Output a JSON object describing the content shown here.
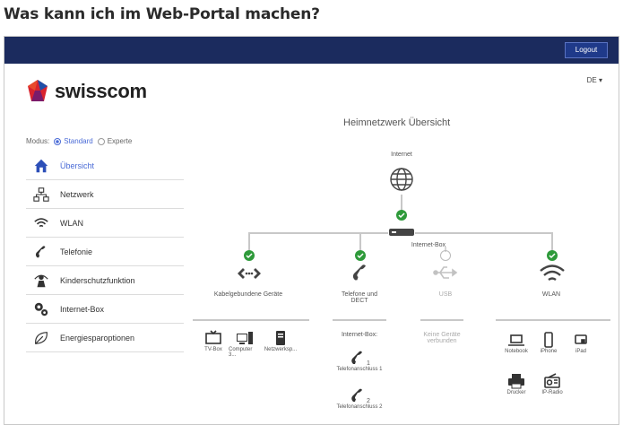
{
  "page_heading": "Was kann ich im Web-Portal machen?",
  "header": {
    "logout_label": "Logout",
    "language": "DE ▾"
  },
  "brand": {
    "name": "swisscom"
  },
  "modus": {
    "label": "Modus:",
    "standard": "Standard",
    "experte": "Experte"
  },
  "sidebar": {
    "items": [
      {
        "label": "Übersicht",
        "icon": "home-icon"
      },
      {
        "label": "Netzwerk",
        "icon": "network-icon"
      },
      {
        "label": "WLAN",
        "icon": "wifi-icon"
      },
      {
        "label": "Telefonie",
        "icon": "phone-icon"
      },
      {
        "label": "Kinderschutzfunktion",
        "icon": "parental-icon"
      },
      {
        "label": "Internet-Box",
        "icon": "gear-icon"
      },
      {
        "label": "Energiesparoptionen",
        "icon": "leaf-icon"
      }
    ]
  },
  "overview": {
    "title": "Heimnetzwerk Übersicht",
    "internet": "Internet",
    "internet_box": "Internet-Box",
    "branches": {
      "wired": "Kabelgebundene Geräte",
      "phone": "Telefone und DECT",
      "usb": "USB",
      "wlan": "WLAN"
    },
    "wired_devices": [
      "TV-Box",
      "Computer 3...",
      "Netzwerksp..."
    ],
    "phone_header": "Internet-Box:",
    "phone_ports": [
      "Telefonanschluss 1",
      "Telefonanschluss 2"
    ],
    "phone_port_numbers": [
      "1",
      "2"
    ],
    "usb_status": "Keine Geräte verbunden",
    "wlan_devices": [
      "Notebook",
      "iPhone",
      "iPad",
      "Drucker",
      "IP-Radio"
    ]
  },
  "colors": {
    "topbar": "#1b2b5e",
    "accent": "#4a6bd6",
    "ok": "#2e9a3a"
  }
}
